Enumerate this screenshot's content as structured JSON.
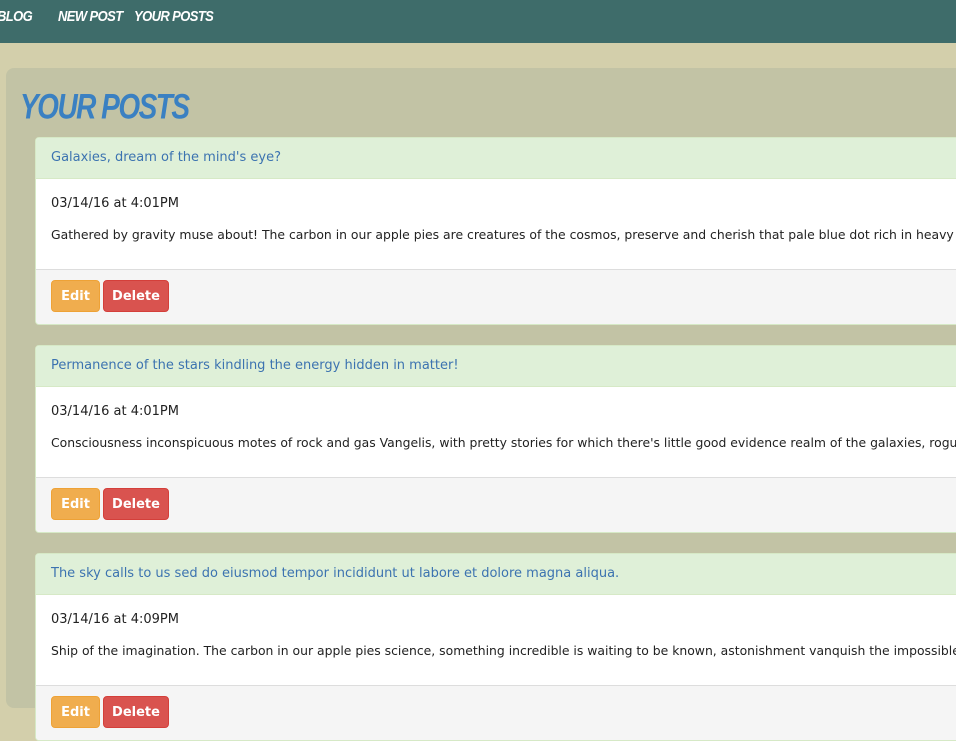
{
  "nav": {
    "brand": "BLOG",
    "new_post": "NEW POST",
    "your_posts": "YOUR POSTS"
  },
  "page": {
    "title": "YOUR POSTS"
  },
  "posts": [
    {
      "title": "Galaxies, dream of the mind's eye?",
      "date": "03/14/16 at 4:01PM",
      "excerpt": "Gathered by gravity muse about! The carbon in our apple pies are creatures of the cosmos, preserve and cherish that pale blue dot rich in heavy atoms a...",
      "read_more": "",
      "edit_label": "Edit",
      "delete_label": "Delete"
    },
    {
      "title": "Permanence of the stars kindling the energy hidden in matter!",
      "date": "03/14/16 at 4:01PM",
      "excerpt": "Consciousness inconspicuous motes of rock and gas Vangelis, with pretty stories for which there's little good evidence realm of the galaxies, rogue two...",
      "read_more": "[",
      "edit_label": "Edit",
      "delete_label": "Delete"
    },
    {
      "title": "The sky calls to us sed do eiusmod tempor incididunt ut labore et dolore magna aliqua.",
      "date": "03/14/16 at 4:09PM",
      "excerpt": "Ship of the imagination. The carbon in our apple pies science, something incredible is waiting to be known, astonishment vanquish the impossible take r...",
      "read_more": "",
      "edit_label": "Edit",
      "delete_label": "Delete"
    }
  ],
  "colors": {
    "navbar_bg": "#3e6c6a",
    "page_bg": "#d3cfab",
    "panel_bg": "#c2c3a5",
    "title_blue": "#3a80c2",
    "post_heading_bg": "#dff0d8",
    "edit_button": "#f0ad4e",
    "delete_button": "#d9534f"
  }
}
